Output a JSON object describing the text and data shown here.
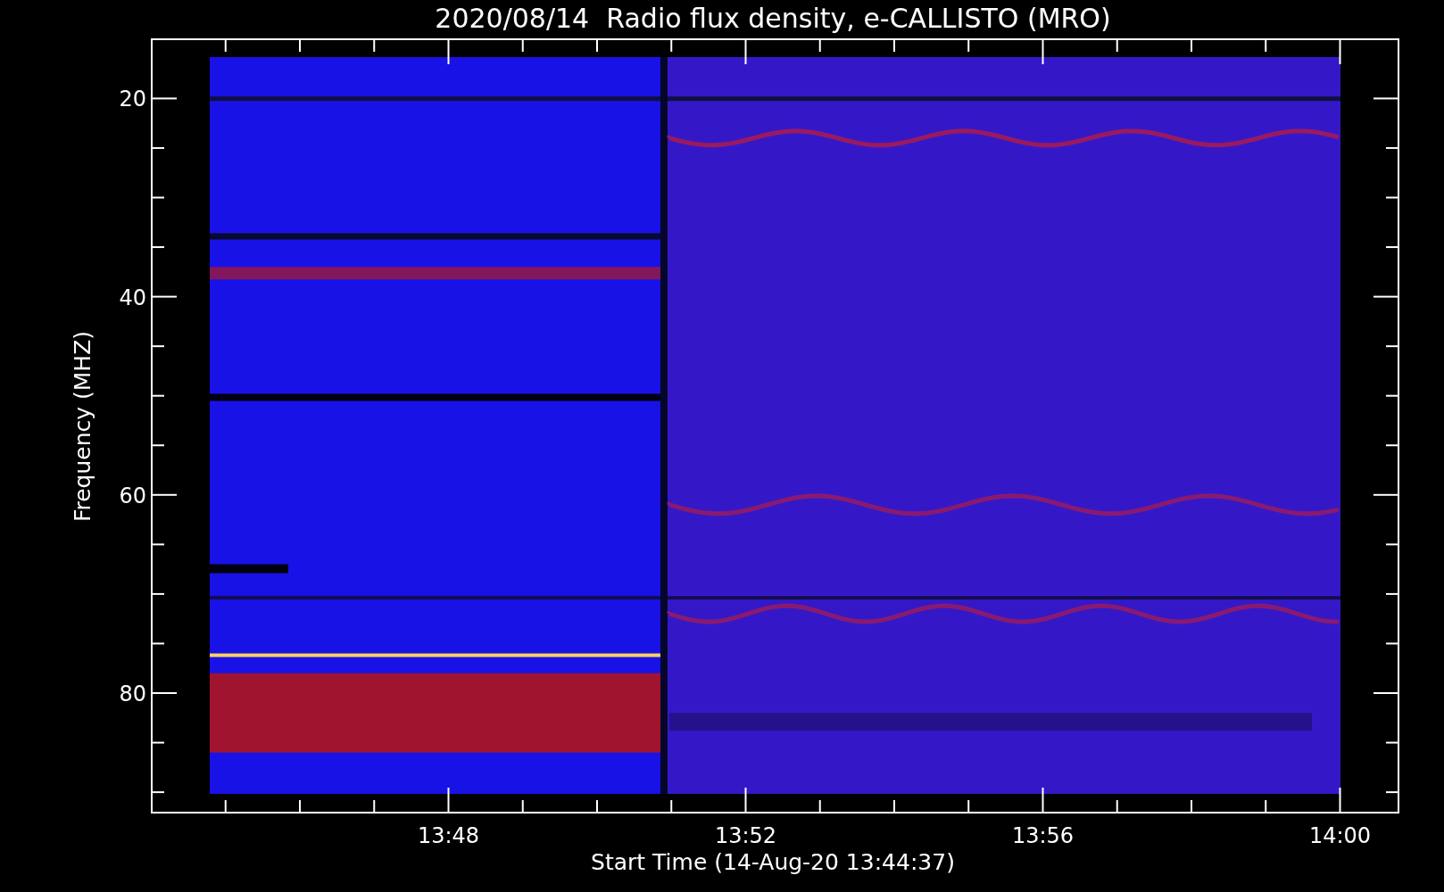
{
  "title": "2020/08/14  Radio flux density, e-CALLISTO (MRO)",
  "y_axis": {
    "label": "Frequency (MHZ)",
    "ticks": [
      "20",
      "40",
      "60",
      "80"
    ]
  },
  "x_axis": {
    "label": "Start Time (14-Aug-20 13:44:37)",
    "ticks": [
      "13:48",
      "13:52",
      "13:56",
      "14:00"
    ]
  }
}
